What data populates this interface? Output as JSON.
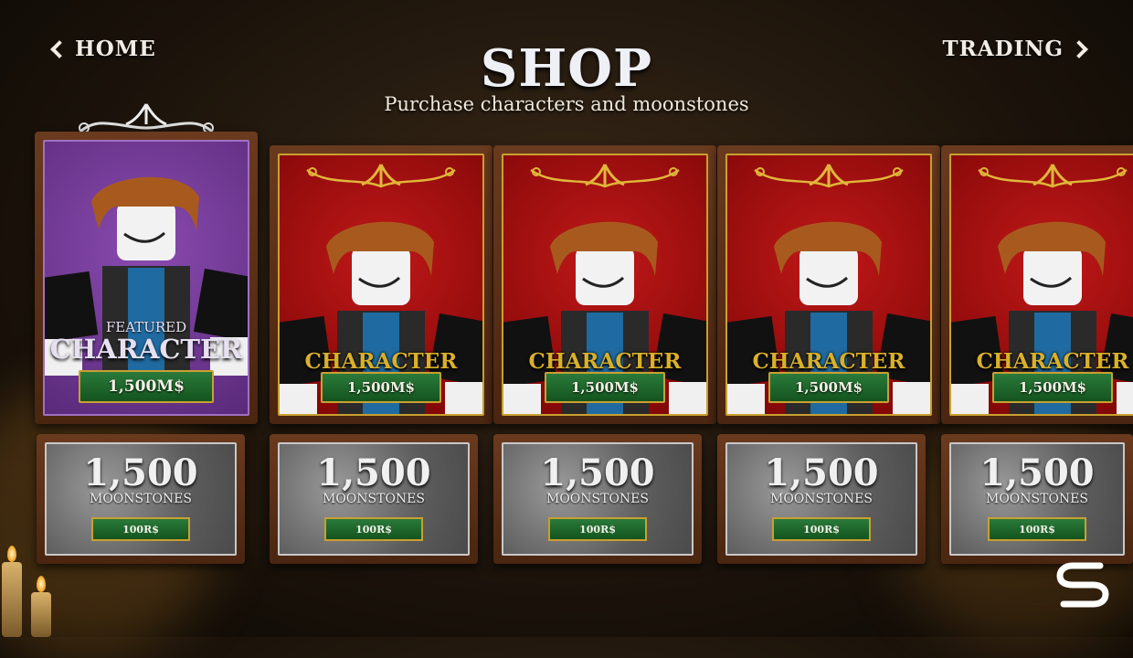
{
  "header": {
    "home_label": "HOME",
    "trading_label": "TRADING",
    "title": "SHOP",
    "subtitle": "Purchase characters and moonstones"
  },
  "featured": {
    "small_label": "FEATURED",
    "big_label": "CHARACTER",
    "price": "1,500M$"
  },
  "characters": [
    {
      "label": "CHARACTER",
      "price": "1,500M$"
    },
    {
      "label": "CHARACTER",
      "price": "1,500M$"
    },
    {
      "label": "CHARACTER",
      "price": "1,500M$"
    },
    {
      "label": "CHARACTER",
      "price": "1,500M$"
    }
  ],
  "moonstones": [
    {
      "amount": "1,500",
      "label": "MOONSTONES",
      "price": "100R$"
    },
    {
      "amount": "1,500",
      "label": "MOONSTONES",
      "price": "100R$"
    },
    {
      "amount": "1,500",
      "label": "MOONSTONES",
      "price": "100R$"
    },
    {
      "amount": "1,500",
      "label": "MOONSTONES",
      "price": "100R$"
    },
    {
      "amount": "1,500",
      "label": "MOONSTONES",
      "price": "100R$"
    }
  ],
  "colors": {
    "gold": "#c9a030",
    "card_red": "#a01010",
    "card_purple": "#7a3fa0",
    "button_green": "#1f6a2c"
  },
  "icons": {
    "logo": "s-logo-icon",
    "nav_left": "chevron-left-icon",
    "nav_right": "chevron-right-icon"
  }
}
